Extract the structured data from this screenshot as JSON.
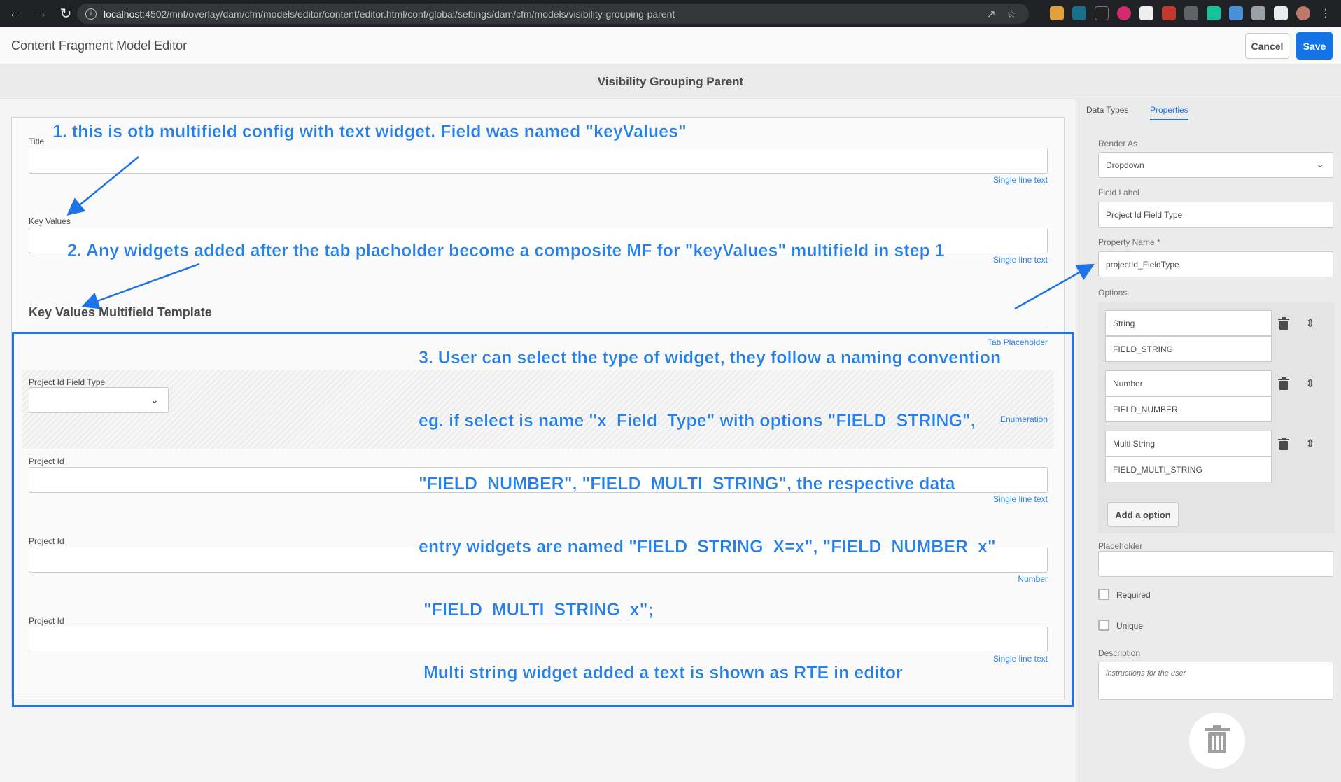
{
  "browser": {
    "url_host": "localhost",
    "url_rest": ":4502/mnt/overlay/dam/cfm/models/editor/content/editor.html/conf/global/settings/dam/cfm/models/visibility-grouping-parent"
  },
  "header": {
    "title": "Content Fragment Model Editor",
    "cancel_label": "Cancel",
    "save_label": "Save"
  },
  "model": {
    "title": "Visibility Grouping Parent"
  },
  "canvas": {
    "fields": [
      {
        "label": "Title",
        "type": "Single line text"
      },
      {
        "label": "Key Values",
        "type": "Single line text"
      }
    ],
    "tab": {
      "title": "Key Values Multifield Template",
      "type": "Tab Placeholder"
    },
    "enum": {
      "label": "Project Id Field Type",
      "type": "Enumeration"
    },
    "template_fields": [
      {
        "label": "Project Id",
        "type": "Single line text"
      },
      {
        "label": "Project Id",
        "type": "Number"
      },
      {
        "label": "Project Id",
        "type": "Single line text"
      }
    ]
  },
  "panel": {
    "tabs": {
      "data_types": "Data Types",
      "properties": "Properties"
    },
    "render_as_label": "Render As",
    "render_as_value": "Dropdown",
    "field_label_label": "Field Label",
    "field_label_value": "Project Id Field Type",
    "property_name_label": "Property Name *",
    "property_name_value": "projectId_FieldType",
    "options_label": "Options",
    "options": [
      {
        "label": "String",
        "value": "FIELD_STRING"
      },
      {
        "label": "Number",
        "value": "FIELD_NUMBER"
      },
      {
        "label": "Multi String",
        "value": "FIELD_MULTI_STRING"
      }
    ],
    "add_option_label": "Add a option",
    "placeholder_label": "Placeholder",
    "required_label": "Required",
    "unique_label": "Unique",
    "description_label": "Description",
    "description_placeholder": "instructions for the user"
  },
  "annotations": {
    "note1": "1. this is otb multifield config with text widget. Field was named \"keyValues\"",
    "note2": "2. Any widgets added after the tab placholder become a composite MF for \"keyValues\" multifield in step 1",
    "note3_lines": [
      "3. User can select the type of widget, they follow a naming convention",
      "eg. if select is name \"x_Field_Type\" with options \"FIELD_STRING\",",
      "\"FIELD_NUMBER\", \"FIELD_MULTI_STRING\", the respective data",
      "entry widgets are named \"FIELD_STRING_X=x\", \"FIELD_NUMBER_x\"",
      " \"FIELD_MULTI_STRING_x\";",
      " Multi string widget added a text is shown as RTE in editor"
    ]
  },
  "colors": {
    "accent": "#1473e6",
    "annotation": "#2680eb"
  }
}
